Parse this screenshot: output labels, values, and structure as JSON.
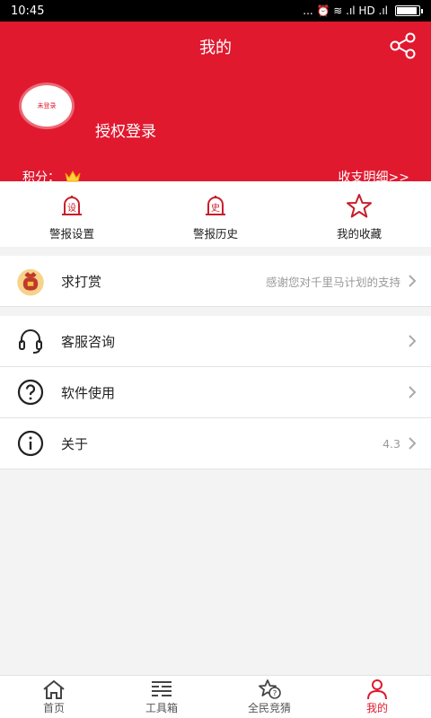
{
  "status_bar": {
    "time": "10:45",
    "signals": "... ⏰ ≋ .ıl HD .ıl"
  },
  "header": {
    "title": "我的",
    "avatar_text": "未登录",
    "login_label": "授权登录",
    "points_label": "积分：",
    "detail_link": "收支明细>>"
  },
  "quick_actions": [
    {
      "label": "警报设置",
      "badge": "设"
    },
    {
      "label": "警报历史",
      "badge": "史"
    },
    {
      "label": "我的收藏"
    }
  ],
  "reward": {
    "label": "求打赏",
    "value": "感谢您对千里马计划的支持"
  },
  "menu": [
    {
      "label": "客服咨询",
      "value": ""
    },
    {
      "label": "软件使用",
      "value": ""
    },
    {
      "label": "关于",
      "value": "4.3"
    }
  ],
  "tabs": [
    {
      "label": "首页"
    },
    {
      "label": "工具箱"
    },
    {
      "label": "全民竞猜"
    },
    {
      "label": "我的"
    }
  ],
  "colors": {
    "accent": "#e0192f"
  }
}
